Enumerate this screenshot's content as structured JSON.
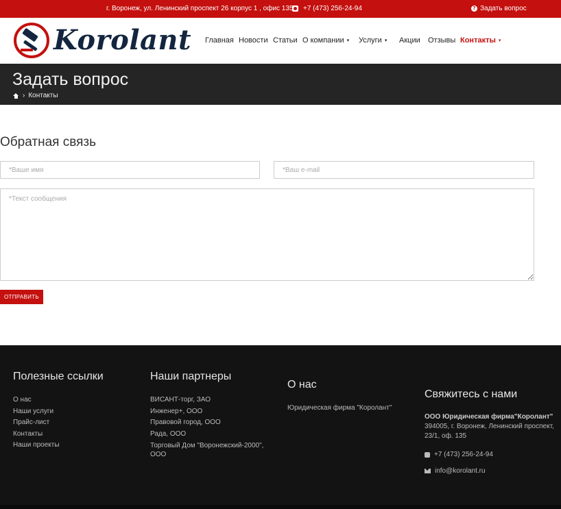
{
  "topbar": {
    "address": "г. Воронеж, ул. Ленинский проспект 26 корпус 1 , офис 135",
    "phone": "+7 (473) 256-24-94",
    "ask": "Задать вопрос"
  },
  "logo": {
    "text": "Korolant"
  },
  "nav": [
    {
      "label": "Главная"
    },
    {
      "label": "Новости"
    },
    {
      "label": "Статьи"
    },
    {
      "label": "О компании"
    },
    {
      "label": "Услуги"
    },
    {
      "label": "Акции"
    },
    {
      "label": "Отзывы"
    },
    {
      "label": "Контакты"
    }
  ],
  "page": {
    "title": "Задать вопрос",
    "breadcrumb": "Контакты"
  },
  "form": {
    "title": "Обратная связь",
    "name_placeholder": "*Ваше имя",
    "email_placeholder": "*Ваш e-mail",
    "message_placeholder": "*Текст сообщения",
    "submit_label": "ОТПРАВИТЬ"
  },
  "footer": {
    "links_title": "Полезные ссылки",
    "links": [
      "О нас",
      "Наши услуги",
      "Прайс-лист",
      "Контакты",
      "Наши проекты"
    ],
    "partners_title": "Наши партнеры",
    "partners": [
      "ВИСАНТ-торг, ЗАО",
      "Инженер+, ООО",
      "Правовой город, ООО",
      "Рада, ООО",
      "Торговый Дом \"Воронежский-2000\", ООО"
    ],
    "about_title": "О нас",
    "about_text": "Юридическая фирма \"Королант\"",
    "contact_title": "Свяжитесь с нами",
    "company_name": "ООО Юридическая фирма\"Королант\"",
    "company_address": "394005, г. Воронеж, Ленинский проспект, 23/1, оф. 135",
    "phone": "+7 (473) 256-24-94",
    "email": "info@korolant.ru"
  },
  "colors": {
    "accent": "#c4100e",
    "title_band": "#252525",
    "footer_bg": "#131313",
    "logo_navy": "#14263f"
  },
  "icons": [
    "phone-icon",
    "question-icon",
    "home-icon",
    "gavel-logo-icon",
    "mail-icon",
    "chevron-down-icon"
  ]
}
